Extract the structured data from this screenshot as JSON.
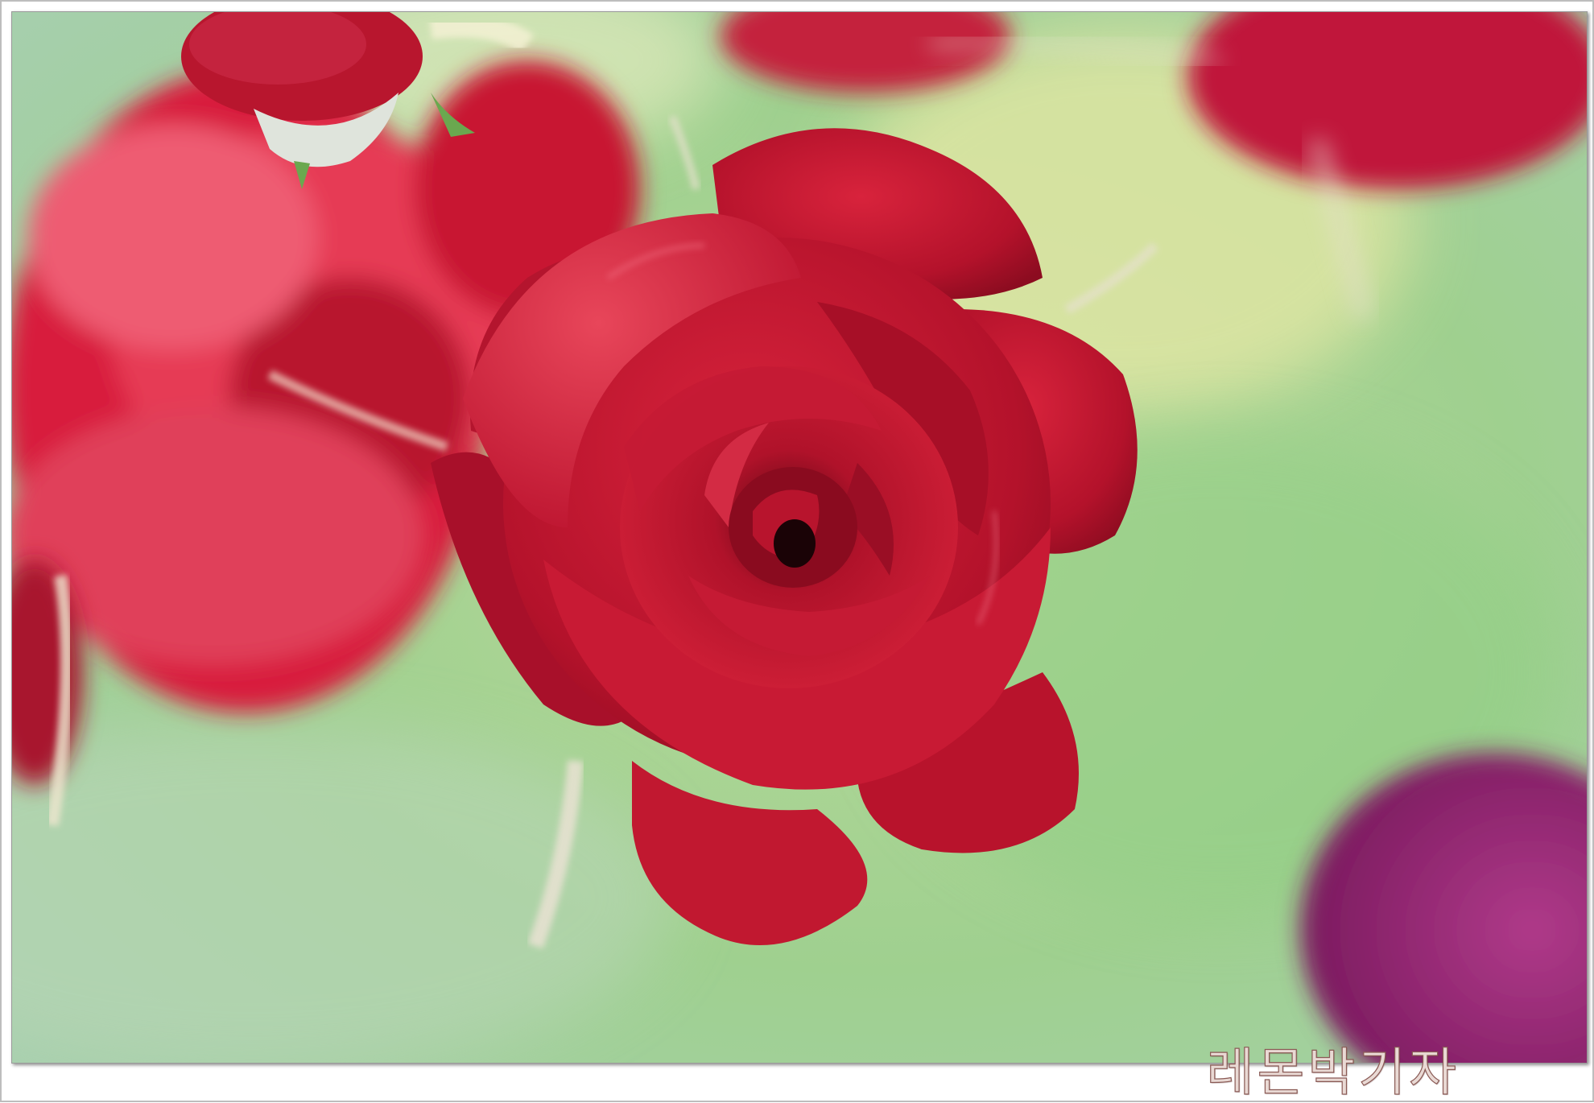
{
  "photo": {
    "subject": "red-rose",
    "colors": {
      "background_green": "#a8d49a",
      "background_yellow": "#e8e6a0",
      "rose_red": "#c0122e",
      "rose_dark": "#7d0a1c",
      "rose_light": "#e4455a",
      "purple_blur": "#9a2a7a"
    }
  },
  "watermark": {
    "text": "레몬박기자"
  }
}
